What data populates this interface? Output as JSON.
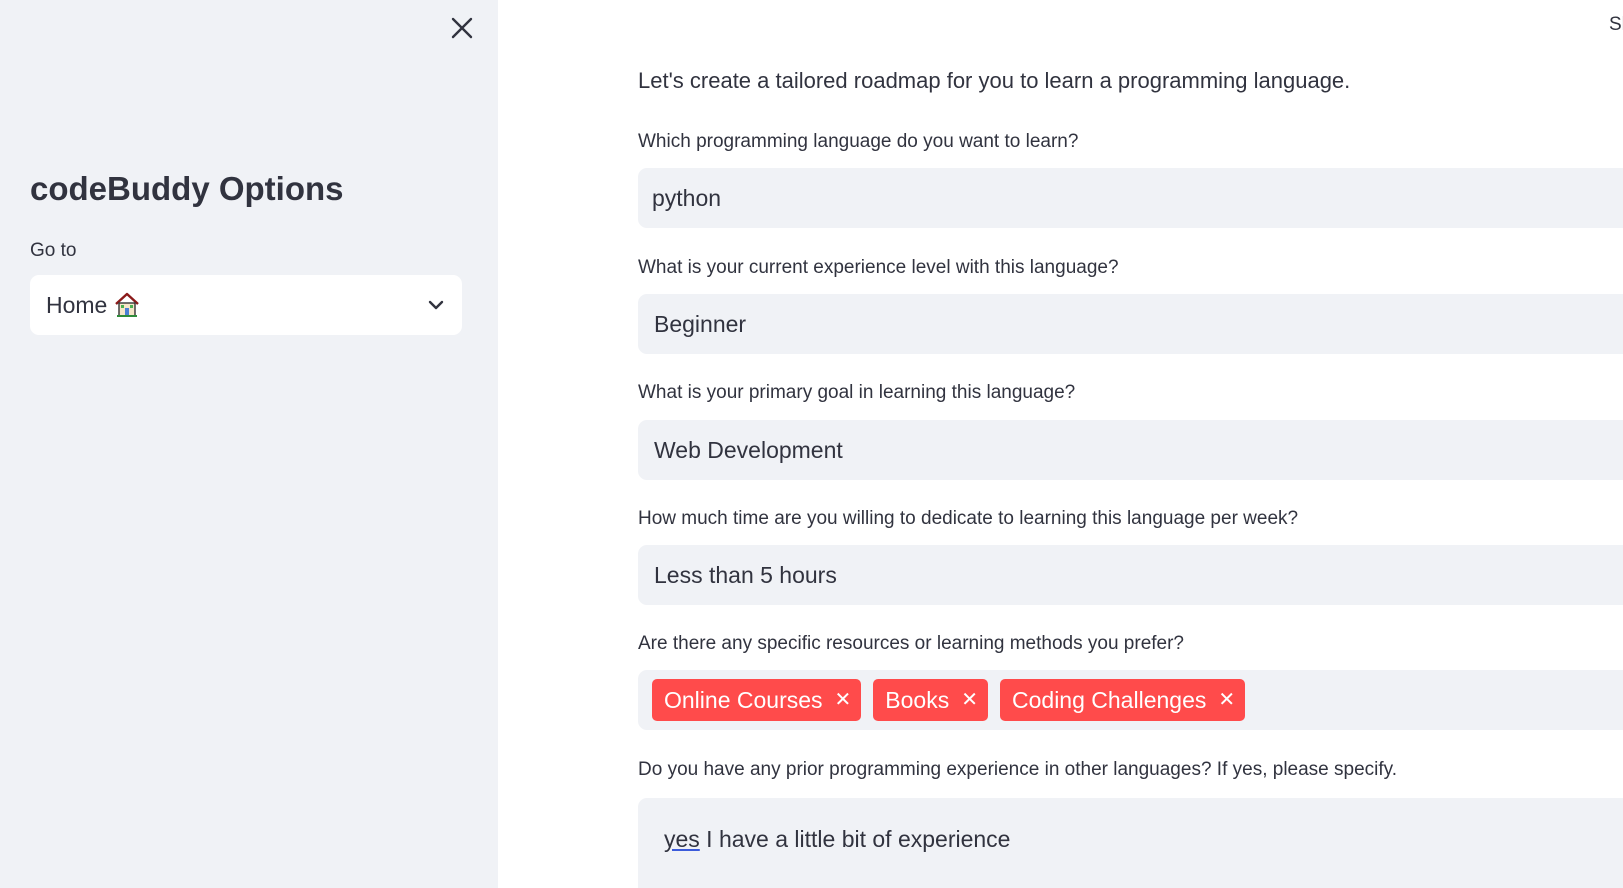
{
  "sidebar": {
    "title": "codeBuddy Options",
    "goto_label": "Go to",
    "nav_value": "Home",
    "nav_icon": "house-emoji",
    "close_icon": "close-icon"
  },
  "main": {
    "top_right_text": "Sh",
    "intro": "Let's create a tailored roadmap for you to learn a programming language.",
    "fields": [
      {
        "label": "Which programming language do you want to learn?",
        "value": "python"
      },
      {
        "label": "What is your current experience level with this language?",
        "value": "Beginner"
      },
      {
        "label": "What is your primary goal in learning this language?",
        "value": "Web Development"
      },
      {
        "label": "How much time are you willing to dedicate to learning this language per week?",
        "value": "Less than 5 hours"
      },
      {
        "label": "Are there any specific resources or learning methods you prefer?",
        "tags": [
          "Online Courses",
          "Books",
          "Coding Challenges"
        ]
      },
      {
        "label": "Do you have any prior programming experience in other languages? If yes, please specify.",
        "value_underlined": "yes",
        "value_rest": " I have a little bit of experience"
      }
    ]
  },
  "colors": {
    "sidebar_bg": "#f0f2f6",
    "input_bg": "#f0f2f6",
    "tag_bg": "#ff4b4b",
    "text": "#31333f"
  }
}
